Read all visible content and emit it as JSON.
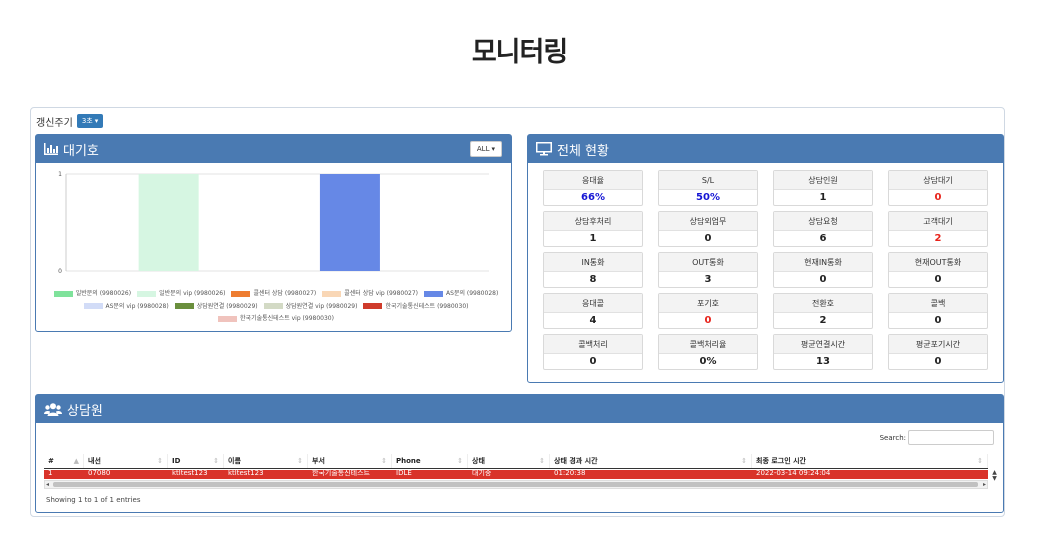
{
  "page": {
    "title": "모니터링"
  },
  "refresh": {
    "label": "갱신주기",
    "value": "3초"
  },
  "waiting": {
    "title": "대기호",
    "filter": "ALL",
    "chart_data": {
      "type": "bar",
      "ylim": [
        0,
        1
      ],
      "yticks": [
        "0",
        "1"
      ],
      "series": [
        {
          "name": "일반문의 (9980026)",
          "color": "#7fe29b",
          "value": 0
        },
        {
          "name": "일반문의 vip (9980026)",
          "color": "#d6f6e2",
          "value": 1
        },
        {
          "name": "콜센터 상담 (9980027)",
          "color": "#ee7d31",
          "value": 0
        },
        {
          "name": "콜센터 상담 vip (9980027)",
          "color": "#f9d7b6",
          "value": 0
        },
        {
          "name": "AS문의 (9980028)",
          "color": "#6688e6",
          "value": 1
        },
        {
          "name": "AS문의 vip (9980028)",
          "color": "#d2dcf7",
          "value": 0
        },
        {
          "name": "상담원연결 (9980029)",
          "color": "#6a8f3d",
          "value": 0
        },
        {
          "name": "상담원연결 vip (9980029)",
          "color": "#d3dac5",
          "value": 0
        },
        {
          "name": "한국기술통신테스트 (9980030)",
          "color": "#cf3b2b",
          "value": 0
        },
        {
          "name": "한국기술통신테스트 vip (9980030)",
          "color": "#f0c3bd",
          "value": 0
        }
      ]
    }
  },
  "status": {
    "title": "전체 현황",
    "cards": [
      {
        "label": "응대율",
        "value": "66%",
        "tone": "blue"
      },
      {
        "label": "S/L",
        "value": "50%",
        "tone": "blue"
      },
      {
        "label": "상담인원",
        "value": "1",
        "tone": "normal"
      },
      {
        "label": "상담대기",
        "value": "0",
        "tone": "red"
      },
      {
        "label": "상담후처리",
        "value": "1",
        "tone": "normal"
      },
      {
        "label": "상담외업무",
        "value": "0",
        "tone": "normal"
      },
      {
        "label": "상담요청",
        "value": "6",
        "tone": "normal"
      },
      {
        "label": "고객대기",
        "value": "2",
        "tone": "red"
      },
      {
        "label": "IN통화",
        "value": "8",
        "tone": "normal"
      },
      {
        "label": "OUT통화",
        "value": "3",
        "tone": "normal"
      },
      {
        "label": "현재IN통화",
        "value": "0",
        "tone": "normal"
      },
      {
        "label": "현재OUT통화",
        "value": "0",
        "tone": "normal"
      },
      {
        "label": "응대콜",
        "value": "4",
        "tone": "normal"
      },
      {
        "label": "포기호",
        "value": "0",
        "tone": "red"
      },
      {
        "label": "전환호",
        "value": "2",
        "tone": "normal"
      },
      {
        "label": "콜백",
        "value": "0",
        "tone": "normal"
      },
      {
        "label": "콜백처리",
        "value": "0",
        "tone": "normal"
      },
      {
        "label": "콜백처리율",
        "value": "0%",
        "tone": "normal"
      },
      {
        "label": "평균연결시간",
        "value": "13",
        "tone": "normal"
      },
      {
        "label": "평균포기시간",
        "value": "0",
        "tone": "normal"
      }
    ]
  },
  "agents": {
    "title": "상담원",
    "search_label": "Search:",
    "columns": [
      "#",
      "내선",
      "ID",
      "이름",
      "부서",
      "Phone",
      "상태",
      "상태 경과 시간",
      "최종 로그인 시간"
    ],
    "rows": [
      [
        "1",
        "07080",
        "ktltest123",
        "ktltest123",
        "한국기술통신테스트",
        "IDLE",
        "대기중",
        "01:20:38",
        "2022-03-14 09:24:04"
      ]
    ],
    "info": "Showing 1 to 1 of 1 entries"
  },
  "colors": {
    "panel_header": "#4a7ab2",
    "row_highlight": "#d9332a",
    "accent_blue": "#1515d4",
    "accent_red": "#e8231b"
  }
}
